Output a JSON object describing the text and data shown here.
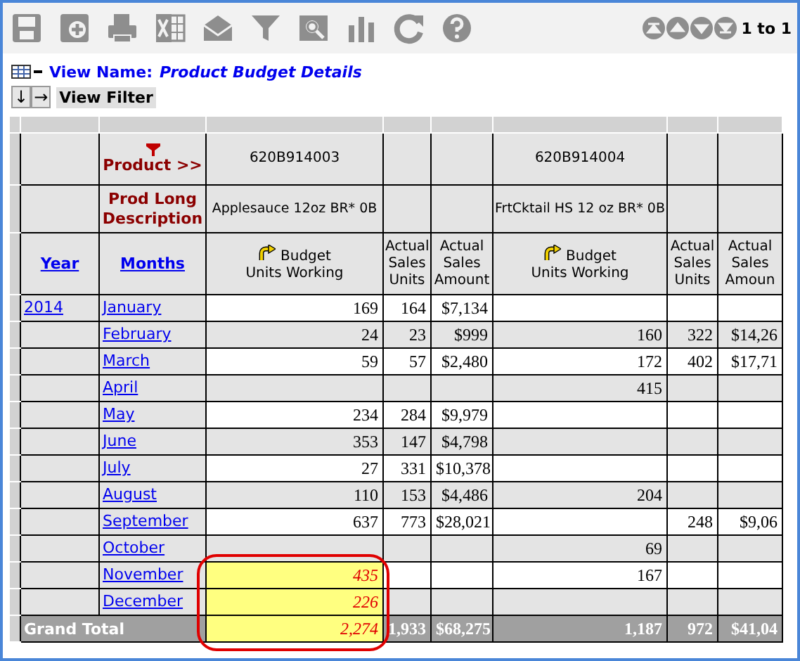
{
  "pager": {
    "range": "1 to 1"
  },
  "view": {
    "name_label": "View Name:",
    "name": "Product Budget Details",
    "filter_buttons": [
      "↓",
      "→"
    ],
    "filter_label": "View Filter"
  },
  "table": {
    "product_label": "Product >>",
    "description_label": "Prod Long Description",
    "year_heading": "Year",
    "months_heading": "Months",
    "callout": true,
    "products": [
      {
        "code": "620B914003",
        "description": "Applesauce 12oz BR* 0B",
        "columns": [
          {
            "kind": "budget",
            "label": "Budget\nUnits Working"
          },
          {
            "kind": "actual",
            "label": "Actual Sales Units"
          },
          {
            "kind": "actual",
            "label": "Actual Sales Amount"
          }
        ]
      },
      {
        "code": "620B914004",
        "description": "FrtCktail HS 12 oz BR* 0B",
        "columns": [
          {
            "kind": "budget",
            "label": "Budget\nUnits Working"
          },
          {
            "kind": "actual",
            "label": "Actual Sales Units"
          },
          {
            "kind": "actual",
            "label": "Actual Sales Amoun"
          }
        ]
      }
    ],
    "rows": [
      {
        "kind": "month",
        "year": "2014",
        "month": "January",
        "cells": [
          {
            "text": "169",
            "highlighted": false
          },
          {
            "text": "164",
            "highlighted": false
          },
          {
            "text": "$7,134",
            "highlighted": false
          },
          {
            "highlighted": false
          },
          {
            "highlighted": false
          },
          {
            "highlighted": false
          }
        ]
      },
      {
        "kind": "month",
        "month": "February",
        "cells": [
          {
            "text": "24",
            "highlighted": false
          },
          {
            "text": "23",
            "highlighted": false
          },
          {
            "text": "$999",
            "highlighted": false
          },
          {
            "text": "160",
            "highlighted": false
          },
          {
            "text": "322",
            "highlighted": false
          },
          {
            "text": "$14,26",
            "highlighted": false
          }
        ]
      },
      {
        "kind": "month",
        "month": "March",
        "cells": [
          {
            "text": "59",
            "highlighted": false
          },
          {
            "text": "57",
            "highlighted": false
          },
          {
            "text": "$2,480",
            "highlighted": false
          },
          {
            "text": "172",
            "highlighted": false
          },
          {
            "text": "402",
            "highlighted": false
          },
          {
            "text": "$17,71",
            "highlighted": false
          }
        ]
      },
      {
        "kind": "month",
        "month": "April",
        "cells": [
          {
            "highlighted": false
          },
          {
            "highlighted": false
          },
          {
            "highlighted": false
          },
          {
            "text": "415",
            "highlighted": false
          },
          {
            "highlighted": false
          },
          {
            "highlighted": false
          }
        ]
      },
      {
        "kind": "month",
        "month": "May",
        "cells": [
          {
            "text": "234",
            "highlighted": false
          },
          {
            "text": "284",
            "highlighted": false
          },
          {
            "text": "$9,979",
            "highlighted": false
          },
          {
            "highlighted": false
          },
          {
            "highlighted": false
          },
          {
            "highlighted": false
          }
        ]
      },
      {
        "kind": "month",
        "month": "June",
        "cells": [
          {
            "text": "353",
            "highlighted": false
          },
          {
            "text": "147",
            "highlighted": false
          },
          {
            "text": "$4,798",
            "highlighted": false
          },
          {
            "highlighted": false
          },
          {
            "highlighted": false
          },
          {
            "highlighted": false
          }
        ]
      },
      {
        "kind": "month",
        "month": "July",
        "cells": [
          {
            "text": "27",
            "highlighted": false
          },
          {
            "text": "331",
            "highlighted": false
          },
          {
            "text": "$10,378",
            "highlighted": false
          },
          {
            "highlighted": false
          },
          {
            "highlighted": false
          },
          {
            "highlighted": false
          }
        ]
      },
      {
        "kind": "month",
        "month": "August",
        "cells": [
          {
            "text": "110",
            "highlighted": false
          },
          {
            "text": "153",
            "highlighted": false
          },
          {
            "text": "$4,486",
            "highlighted": false
          },
          {
            "text": "204",
            "highlighted": false
          },
          {
            "highlighted": false
          },
          {
            "highlighted": false
          }
        ]
      },
      {
        "kind": "month",
        "month": "September",
        "cells": [
          {
            "text": "637",
            "highlighted": false
          },
          {
            "text": "773",
            "highlighted": false
          },
          {
            "text": "$28,021",
            "highlighted": false
          },
          {
            "highlighted": false
          },
          {
            "text": "248",
            "highlighted": false
          },
          {
            "text": "$9,06",
            "highlighted": false
          }
        ]
      },
      {
        "kind": "month",
        "month": "October",
        "cells": [
          {
            "highlighted": false
          },
          {
            "highlighted": false
          },
          {
            "highlighted": false
          },
          {
            "text": "69",
            "highlighted": false
          },
          {
            "highlighted": false
          },
          {
            "highlighted": false
          }
        ]
      },
      {
        "kind": "month",
        "month": "November",
        "cells": [
          {
            "text": "435",
            "highlighted": true
          },
          {
            "highlighted": false
          },
          {
            "highlighted": false
          },
          {
            "text": "167",
            "highlighted": false
          },
          {
            "highlighted": false
          },
          {
            "highlighted": false
          }
        ]
      },
      {
        "kind": "month",
        "month": "December",
        "cells": [
          {
            "text": "226",
            "highlighted": true
          },
          {
            "highlighted": false
          },
          {
            "highlighted": false
          },
          {
            "highlighted": false
          },
          {
            "highlighted": false
          },
          {
            "highlighted": false
          }
        ]
      },
      {
        "kind": "total",
        "label": "Grand Total",
        "cells": [
          {
            "text": "2,274",
            "highlighted": true
          },
          {
            "text": "1,933",
            "highlighted": false
          },
          {
            "text": "$68,275",
            "highlighted": false
          },
          {
            "text": "1,187",
            "highlighted": false
          },
          {
            "text": "972",
            "highlighted": false
          },
          {
            "text": "$41,04",
            "highlighted": false
          }
        ]
      }
    ]
  }
}
